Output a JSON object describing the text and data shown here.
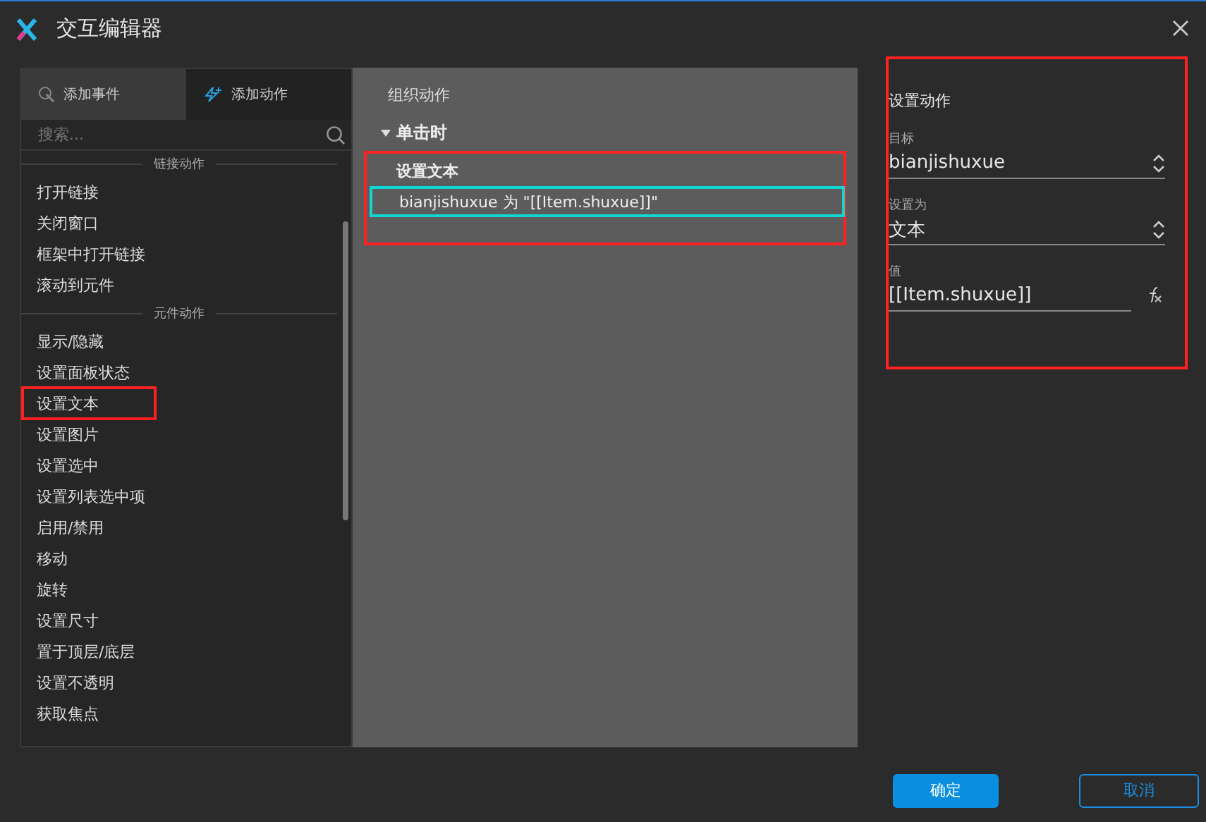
{
  "window": {
    "title": "交互编辑器"
  },
  "tabs": [
    {
      "label": "添加事件",
      "selected": false
    },
    {
      "label": "添加动作",
      "selected": true
    }
  ],
  "search": {
    "placeholder": "搜索..."
  },
  "action_groups": [
    {
      "heading": "链接动作",
      "items": [
        {
          "label": "打开链接",
          "highlighted": false
        },
        {
          "label": "关闭窗口",
          "highlighted": false
        },
        {
          "label": "框架中打开链接",
          "highlighted": false
        },
        {
          "label": "滚动到元件",
          "highlighted": false
        }
      ]
    },
    {
      "heading": "元件动作",
      "items": [
        {
          "label": "显示/隐藏",
          "highlighted": false
        },
        {
          "label": "设置面板状态",
          "highlighted": false
        },
        {
          "label": "设置文本",
          "highlighted": true
        },
        {
          "label": "设置图片",
          "highlighted": false
        },
        {
          "label": "设置选中",
          "highlighted": false
        },
        {
          "label": "设置列表选中项",
          "highlighted": false
        },
        {
          "label": "启用/禁用",
          "highlighted": false
        },
        {
          "label": "移动",
          "highlighted": false
        },
        {
          "label": "旋转",
          "highlighted": false
        },
        {
          "label": "设置尺寸",
          "highlighted": false
        },
        {
          "label": "置于顶层/底层",
          "highlighted": false
        },
        {
          "label": "设置不透明",
          "highlighted": false
        },
        {
          "label": "获取焦点",
          "highlighted": false
        }
      ]
    }
  ],
  "organize": {
    "title": "组织动作",
    "event": {
      "label": "单击时",
      "expanded": true,
      "highlighted": true,
      "action": {
        "title": "设置文本",
        "detail": "bianjishuxue 为 \"[[Item.shuxue]]\"",
        "selected": true
      }
    }
  },
  "settings": {
    "title": "设置动作",
    "highlighted": true,
    "target": {
      "label": "目标",
      "value": "bianjishuxue"
    },
    "set_to": {
      "label": "设置为",
      "value": "文本"
    },
    "value": {
      "label": "值",
      "value": "[[Item.shuxue]]"
    }
  },
  "buttons": [
    {
      "label": "确定",
      "kind": "primary"
    },
    {
      "label": "取消",
      "kind": "secondary"
    }
  ]
}
